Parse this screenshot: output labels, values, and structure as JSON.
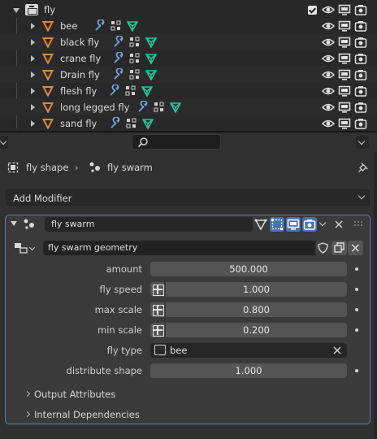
{
  "outliner": {
    "collection": {
      "label": "fly",
      "checked": true
    },
    "objects": [
      {
        "label": "bee"
      },
      {
        "label": "black fly"
      },
      {
        "label": "crane fly"
      },
      {
        "label": "Drain fly"
      },
      {
        "label": "flesh fly"
      },
      {
        "label": "long legged fly"
      },
      {
        "label": "sand fly"
      }
    ]
  },
  "properties": {
    "search": {
      "placeholder": ""
    },
    "breadcrumb": {
      "object": "fly shape",
      "modifier": "fly swarm"
    },
    "add_modifier": {
      "label": "Add Modifier"
    },
    "modifier": {
      "name": "fly swarm",
      "node_group": "fly swarm geometry",
      "inputs": [
        {
          "label": "amount",
          "value": "500.000"
        },
        {
          "label": "fly speed",
          "value": "1.000"
        },
        {
          "label": "max scale",
          "value": "0.800"
        },
        {
          "label": "min scale",
          "value": "0.200"
        },
        {
          "label": "fly type",
          "value": "bee"
        },
        {
          "label": "distribute shape",
          "value": "1.000"
        }
      ],
      "subpanels": [
        {
          "label": "Output Attributes"
        },
        {
          "label": "Internal Dependencies"
        }
      ]
    }
  },
  "colors": {
    "accent": "#4772b3",
    "mesh_icon": "#e0893a",
    "modifier_icon": "#6ea6e0",
    "data_icon": "#29c3a0"
  }
}
